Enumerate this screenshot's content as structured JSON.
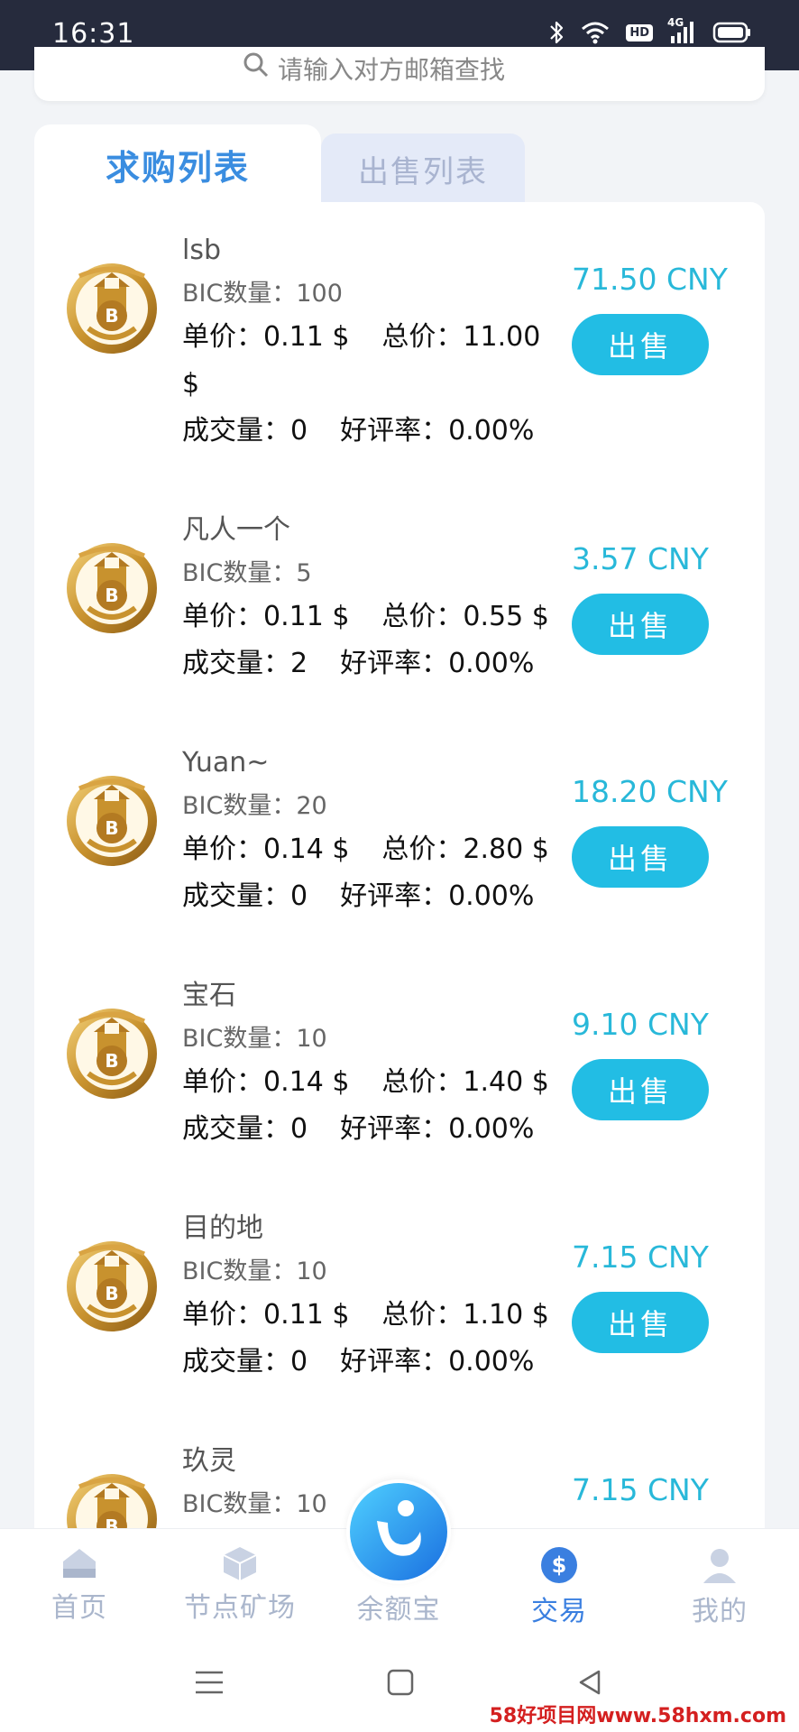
{
  "status_bar": {
    "time": "16:31",
    "hd_badge": "HD",
    "network": "4G",
    "icons": [
      "bluetooth-icon",
      "wifi-icon",
      "hd-icon",
      "signal-icon",
      "battery-icon"
    ]
  },
  "search": {
    "placeholder": "请输入对方邮箱查找",
    "icon": "search-icon"
  },
  "tabs": [
    {
      "label": "求购列表",
      "active": true
    },
    {
      "label": "出售列表",
      "active": false
    }
  ],
  "colors": {
    "accent": "#22bde4",
    "price": "#28b8d9",
    "tab_active": "#3a8de0",
    "status_bar": "#262b3d"
  },
  "list": {
    "items": [
      {
        "name": "lsb",
        "qty": "BIC数量：100",
        "unit_price": "单价：0.11 $",
        "total": "总价：11.00 $",
        "deals": "成交量：0",
        "rating": "好评率：0.00%",
        "price_cny": "71.50 CNY",
        "action": "出售"
      },
      {
        "name": "凡人一个",
        "qty": "BIC数量：5",
        "unit_price": "单价：0.11 $",
        "total": "总价：0.55 $",
        "deals": "成交量：2",
        "rating": "好评率：0.00%",
        "price_cny": "3.57 CNY",
        "action": "出售"
      },
      {
        "name": "Yuan~",
        "qty": "BIC数量：20",
        "unit_price": "单价：0.14 $",
        "total": "总价：2.80 $",
        "deals": "成交量：0",
        "rating": "好评率：0.00%",
        "price_cny": "18.20 CNY",
        "action": "出售"
      },
      {
        "name": "宝石",
        "qty": "BIC数量：10",
        "unit_price": "单价：0.14 $",
        "total": "总价：1.40 $",
        "deals": "成交量：0",
        "rating": "好评率：0.00%",
        "price_cny": "9.10 CNY",
        "action": "出售"
      },
      {
        "name": "目的地",
        "qty": "BIC数量：10",
        "unit_price": "单价：0.11 $",
        "total": "总价：1.10 $",
        "deals": "成交量：0",
        "rating": "好评率：0.00%",
        "price_cny": "7.15 CNY",
        "action": "出售"
      },
      {
        "name": "玖灵",
        "qty": "BIC数量：10",
        "unit_price": "",
        "total": "",
        "deals": "",
        "rating": "",
        "price_cny": "7.15 CNY",
        "action": ""
      }
    ]
  },
  "bottom_nav": {
    "items": [
      {
        "label": "首页",
        "icon": "home-icon",
        "active": false
      },
      {
        "label": "节点矿场",
        "icon": "cube-icon",
        "active": false
      },
      {
        "label": "余额宝",
        "icon": "balance-logo-icon",
        "active": false
      },
      {
        "label": "交易",
        "icon": "dollar-icon",
        "active": true
      },
      {
        "label": "我的",
        "icon": "user-icon",
        "active": false
      }
    ]
  },
  "system_nav": {
    "icons": [
      "menu-icon",
      "home-square-icon",
      "back-triangle-icon"
    ]
  },
  "watermark": "58好项目网www.58hxm.com"
}
